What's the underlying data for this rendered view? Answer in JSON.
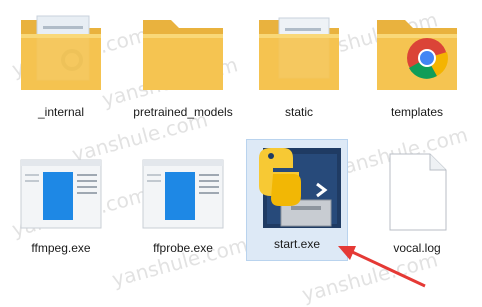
{
  "files": [
    {
      "label": "_internal",
      "icon": "folder-icon"
    },
    {
      "label": "pretrained_models",
      "icon": "folder-icon"
    },
    {
      "label": "static",
      "icon": "folder-icon"
    },
    {
      "label": "templates",
      "icon": "folder-chrome-icon"
    },
    {
      "label": "ffmpeg.exe",
      "icon": "exe-window-icon"
    },
    {
      "label": "ffprobe.exe",
      "icon": "exe-window-icon"
    },
    {
      "label": "start.exe",
      "icon": "python-exe-icon",
      "selected": true
    },
    {
      "label": "vocal.log",
      "icon": "document-icon"
    }
  ],
  "watermark": "yanshule.com",
  "colors": {
    "folder": "#f5c451",
    "selection": "#dde9f6",
    "arrow": "#e53935",
    "exe_blue": "#1e88e5"
  }
}
